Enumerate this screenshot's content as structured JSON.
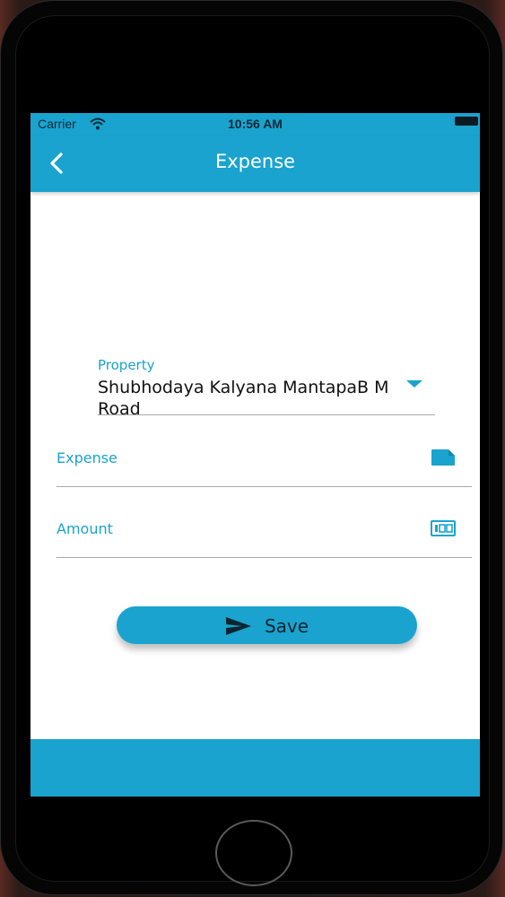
{
  "status_bar": {
    "carrier": "Carrier",
    "time": "10:56 AM",
    "icons": [
      "wifi-icon",
      "battery-icon"
    ]
  },
  "nav": {
    "title": "Expense",
    "back_icon": "chevron-left-icon"
  },
  "form": {
    "property": {
      "label": "Property",
      "value": "Shubhodaya Kalyana MantapaB M Road",
      "icon": "dropdown-arrow-icon"
    },
    "expense": {
      "placeholder": "Expense",
      "value": "",
      "icon": "note-icon"
    },
    "amount": {
      "placeholder": "Amount",
      "value": "",
      "icon": "numbers-icon"
    }
  },
  "save_button": {
    "label": "Save",
    "icon": "send-icon"
  },
  "colors": {
    "accent": "#1aa3cf",
    "background": "#ffffff",
    "underline": "#a8a8a8",
    "text": "#111111"
  }
}
